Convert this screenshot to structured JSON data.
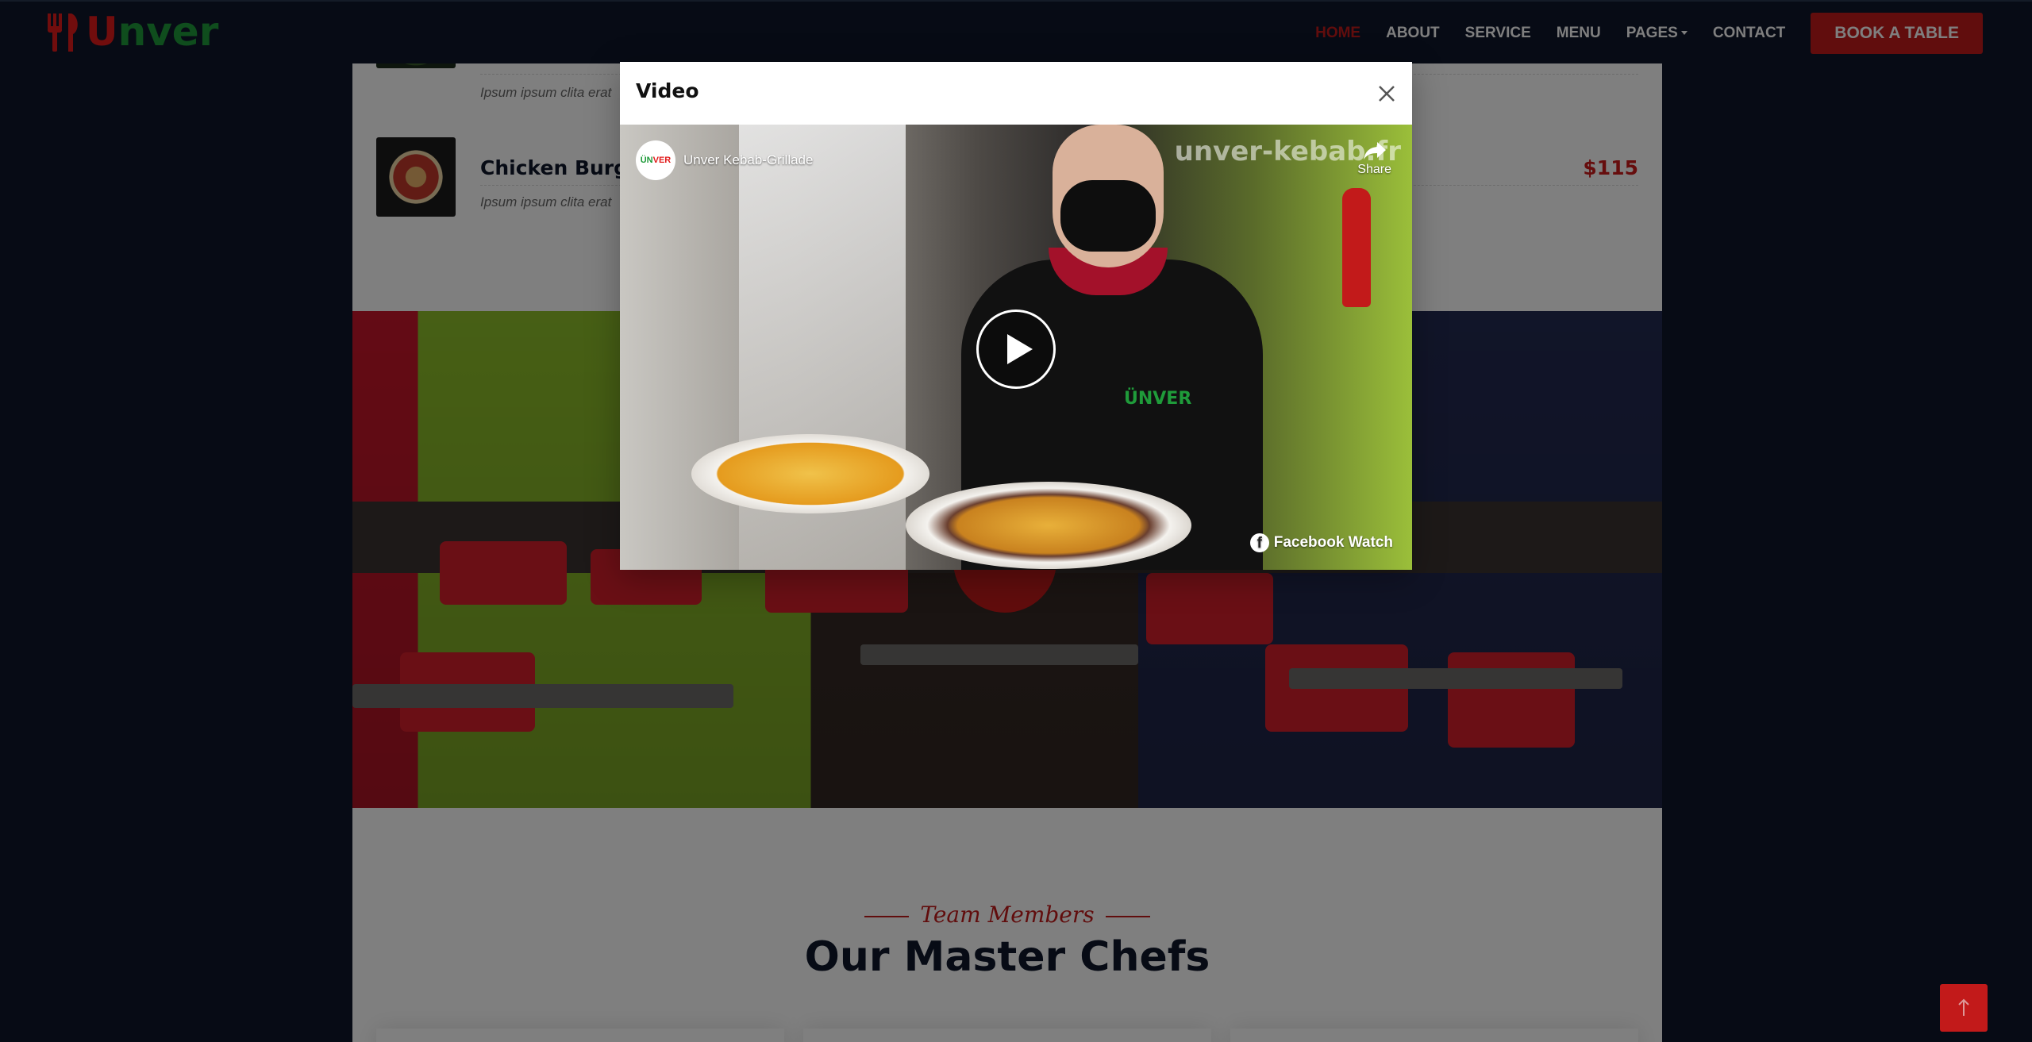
{
  "navbar": {
    "brand": {
      "name_first": "U",
      "name_rest": "nver"
    },
    "links": [
      {
        "label": "HOME",
        "active": true
      },
      {
        "label": "ABOUT",
        "active": false
      },
      {
        "label": "SERVICE",
        "active": false
      },
      {
        "label": "MENU",
        "active": false
      },
      {
        "label": "PAGES",
        "active": false,
        "dropdown": true
      },
      {
        "label": "CONTACT",
        "active": false
      }
    ],
    "cta": "BOOK A TABLE"
  },
  "menu_items": [
    {
      "title": "",
      "desc": "Ipsum ipsum clita erat",
      "price": ""
    },
    {
      "title": "Chicken Burger",
      "desc": "Ipsum ipsum clita erat",
      "price": "$115"
    }
  ],
  "team_section": {
    "tag": "Team Members",
    "title": "Our Master Chefs"
  },
  "modal": {
    "title": "Video",
    "close_icon": "close-icon",
    "video": {
      "channel_avatar_text_green": "ÜN",
      "channel_avatar_text_red": "VER",
      "channel_name": "Unver Kebab-Grillade",
      "watermark": "unver-kebab.fr",
      "share_label": "Share",
      "shirt_logo": "ÜNVER",
      "provider_label": "Facebook Watch"
    }
  },
  "colors": {
    "navbar_bg": "#0f172b",
    "accent_red": "#c21a1a",
    "brand_green": "#1f9b3a"
  }
}
